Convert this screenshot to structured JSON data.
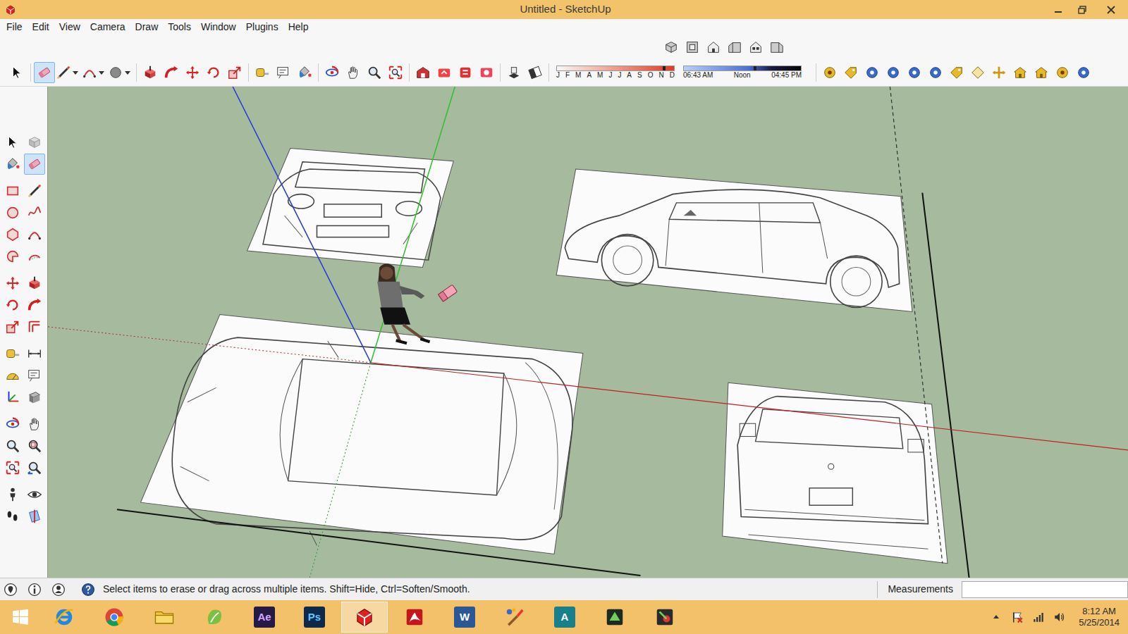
{
  "window": {
    "title": "Untitled - SketchUp"
  },
  "menu": [
    {
      "label": "File"
    },
    {
      "label": "Edit"
    },
    {
      "label": "View"
    },
    {
      "label": "Camera"
    },
    {
      "label": "Draw"
    },
    {
      "label": "Tools"
    },
    {
      "label": "Window"
    },
    {
      "label": "Plugins"
    },
    {
      "label": "Help"
    }
  ],
  "views_toolbar": [
    {
      "kind": "view-iso"
    },
    {
      "kind": "view-top"
    },
    {
      "kind": "view-front"
    },
    {
      "kind": "view-right"
    },
    {
      "kind": "view-back"
    },
    {
      "kind": "view-left"
    }
  ],
  "main_toolbar": [
    [
      {
        "kind": "select",
        "selected": false,
        "dropdown": false
      }
    ],
    [
      {
        "kind": "eraser",
        "selected": true,
        "dropdown": false
      },
      {
        "kind": "line",
        "selected": false,
        "dropdown": true
      },
      {
        "kind": "arc",
        "selected": false,
        "dropdown": true
      },
      {
        "kind": "shape",
        "selected": false,
        "dropdown": true
      }
    ],
    [
      {
        "kind": "pushpull",
        "selected": false,
        "dropdown": false
      },
      {
        "kind": "followme",
        "selected": false,
        "dropdown": false
      },
      {
        "kind": "move",
        "selected": false,
        "dropdown": false
      },
      {
        "kind": "rotate",
        "selected": false,
        "dropdown": false
      },
      {
        "kind": "scale",
        "selected": false,
        "dropdown": false
      }
    ],
    [
      {
        "kind": "tape",
        "selected": false,
        "dropdown": false
      },
      {
        "kind": "text",
        "selected": false,
        "dropdown": false
      },
      {
        "kind": "paint",
        "selected": false,
        "dropdown": false
      }
    ],
    [
      {
        "kind": "orbit",
        "selected": false,
        "dropdown": false
      },
      {
        "kind": "pan",
        "selected": false,
        "dropdown": false
      },
      {
        "kind": "zoom",
        "selected": false,
        "dropdown": false
      },
      {
        "kind": "zoomext",
        "selected": false,
        "dropdown": false
      }
    ],
    [
      {
        "kind": "warehouse",
        "selected": false,
        "dropdown": false
      },
      {
        "kind": "share",
        "selected": false,
        "dropdown": false
      },
      {
        "kind": "components3d",
        "selected": false,
        "dropdown": false
      },
      {
        "kind": "extension",
        "selected": false,
        "dropdown": false
      }
    ],
    [
      {
        "kind": "shadows",
        "selected": false,
        "dropdown": false
      },
      {
        "kind": "fog",
        "selected": false,
        "dropdown": false
      }
    ]
  ],
  "shadow": {
    "months": [
      "J",
      "F",
      "M",
      "A",
      "M",
      "J",
      "J",
      "A",
      "S",
      "O",
      "N",
      "D"
    ],
    "month_level": 0.93,
    "times": [
      "06:43 AM",
      "Noon",
      "04:45 PM"
    ],
    "time_level": 0.62
  },
  "plugins": [
    {
      "kind": "plug-gold"
    },
    {
      "kind": "plug-tag"
    },
    {
      "kind": "plug-blue"
    },
    {
      "kind": "plug-blue"
    },
    {
      "kind": "plug-blue"
    },
    {
      "kind": "plug-blue"
    },
    {
      "kind": "plug-tag"
    },
    {
      "kind": "plug-diamond"
    },
    {
      "kind": "plug-arrows"
    },
    {
      "kind": "plug-house"
    },
    {
      "kind": "plug-house"
    },
    {
      "kind": "plug-gold"
    },
    {
      "kind": "plug-blue"
    }
  ],
  "left_toolbar": [
    [
      {
        "kind": "select",
        "selected": false
      },
      {
        "kind": "component",
        "selected": false
      },
      {
        "kind": "paint",
        "selected": false
      },
      {
        "kind": "eraser",
        "selected": true
      }
    ],
    [
      {
        "kind": "rectangle",
        "selected": false
      },
      {
        "kind": "line",
        "selected": false
      },
      {
        "kind": "circle",
        "selected": false
      },
      {
        "kind": "freehand",
        "selected": false
      },
      {
        "kind": "polygon",
        "selected": false
      },
      {
        "kind": "arc",
        "selected": false
      },
      {
        "kind": "pie",
        "selected": false
      },
      {
        "kind": "arc3",
        "selected": false
      }
    ],
    [
      {
        "kind": "move",
        "selected": false
      },
      {
        "kind": "pushpull",
        "selected": false
      },
      {
        "kind": "rotate",
        "selected": false
      },
      {
        "kind": "followme",
        "selected": false
      },
      {
        "kind": "scale",
        "selected": false
      },
      {
        "kind": "offset",
        "selected": false
      }
    ],
    [
      {
        "kind": "tape",
        "selected": false
      },
      {
        "kind": "dimension",
        "selected": false
      },
      {
        "kind": "protractor",
        "selected": false
      },
      {
        "kind": "text",
        "selected": false
      },
      {
        "kind": "axes",
        "selected": false
      },
      {
        "kind": "text3d",
        "selected": false
      }
    ],
    [
      {
        "kind": "orbit",
        "selected": false
      },
      {
        "kind": "pan",
        "selected": false
      },
      {
        "kind": "zoom",
        "selected": false
      },
      {
        "kind": "zoomwindow",
        "selected": false
      },
      {
        "kind": "zoomext",
        "selected": false
      },
      {
        "kind": "previous",
        "selected": false
      }
    ],
    [
      {
        "kind": "position",
        "selected": false
      },
      {
        "kind": "look",
        "selected": false
      },
      {
        "kind": "walk",
        "selected": false
      },
      {
        "kind": "section",
        "selected": false
      }
    ]
  ],
  "status_bar": {
    "hint": "Select items to erase or drag across multiple items. Shift=Hide, Ctrl=Soften/Smooth.",
    "measurements_label": "Measurements"
  },
  "taskbar": {
    "apps": [
      {
        "kind": "ie",
        "selected": false
      },
      {
        "kind": "chrome",
        "selected": false
      },
      {
        "kind": "explorer",
        "selected": false
      },
      {
        "kind": "evernote",
        "selected": false
      },
      {
        "kind": "ae",
        "label": "Ae",
        "selected": false
      },
      {
        "kind": "ps",
        "label": "Ps",
        "selected": false
      },
      {
        "kind": "sketchup",
        "selected": true
      },
      {
        "kind": "acrobat",
        "selected": false
      },
      {
        "kind": "word",
        "label": "W",
        "selected": false
      },
      {
        "kind": "paintapp",
        "selected": false
      },
      {
        "kind": "autocad",
        "label": "A",
        "selected": false
      },
      {
        "kind": "app1",
        "selected": false
      },
      {
        "kind": "app2",
        "selected": false
      }
    ],
    "time": "8:12 AM",
    "date": "5/25/2014"
  }
}
